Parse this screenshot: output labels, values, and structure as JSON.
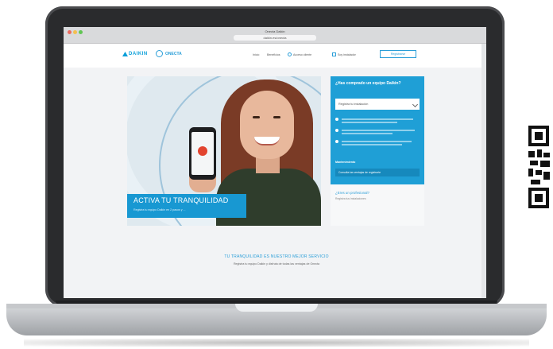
{
  "browser": {
    "tab_title": "Onecta Daikin",
    "url": "daikin.es/onecta"
  },
  "header": {
    "brand": "DAIKIN",
    "product": "ONECTA",
    "nav": [
      "Inicio",
      "Beneficios",
      "Acceso cliente",
      "Soy instalador",
      "Registrarse"
    ]
  },
  "hero": {
    "headline": "ACTIVA TU TRANQUILIDAD",
    "subtext": "Registra tu equipo Daikin en 2 pasos y ..."
  },
  "panel": {
    "title": "¿Has comprado un equipo Daikin?",
    "select_placeholder": "Registra tu instalación",
    "section_label": "Mantenimiento",
    "button_label": "Consulta las ventajas de registrarte",
    "pro_title": "¿Eres un profesional?",
    "pro_sub": "Registra tus instalaciones"
  },
  "section": {
    "heading": "TU TRANQUILIDAD ES NUESTRO MEJOR SERVICIO",
    "sub": "Registra tu equipo Daikin y disfruta de todas las ventajas de Onecta"
  },
  "colors": {
    "brand_blue": "#1f9fd6",
    "laptop_body": "#2a2b2d"
  }
}
